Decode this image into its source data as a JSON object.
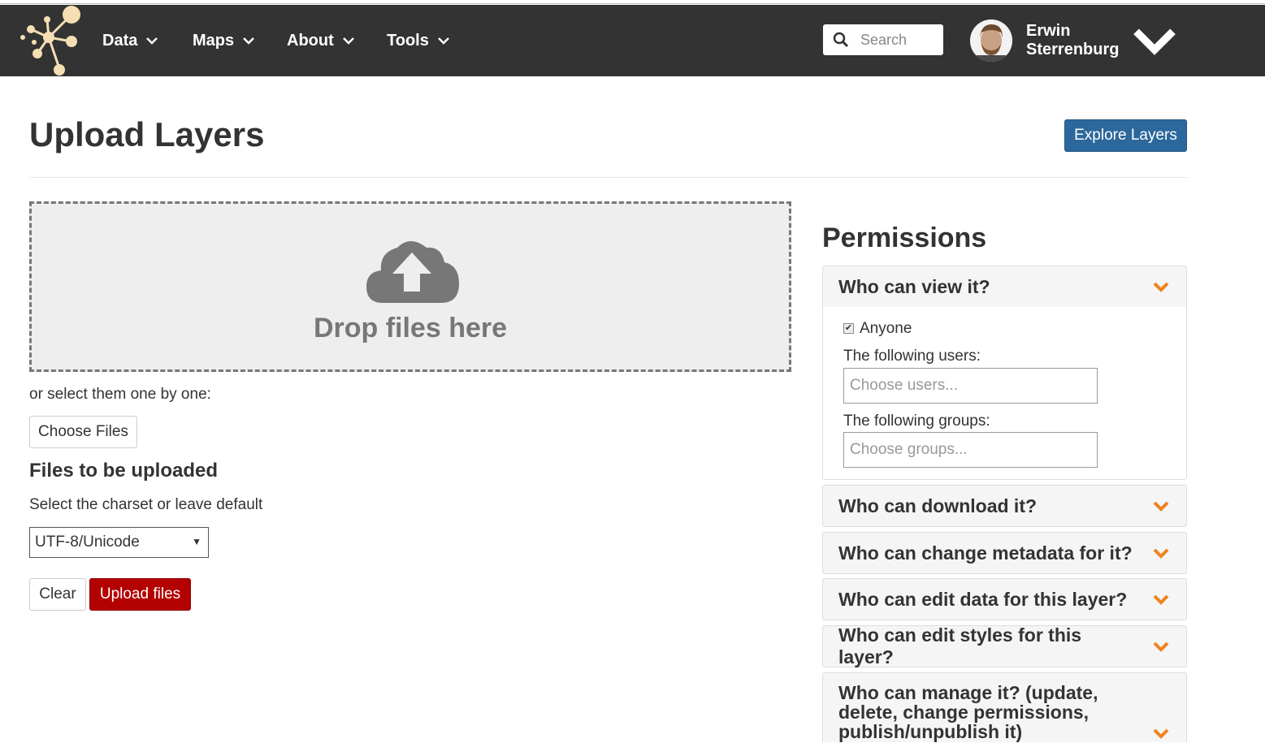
{
  "nav": {
    "items": [
      {
        "label": "Data"
      },
      {
        "label": "Maps"
      },
      {
        "label": "About"
      },
      {
        "label": "Tools"
      }
    ],
    "search_placeholder": "Search",
    "user_name": "Erwin Sterrenburg"
  },
  "header": {
    "title": "Upload Layers",
    "explore_button": "Explore Layers"
  },
  "upload": {
    "drop_text": "Drop files here",
    "select_hint": "or select them one by one:",
    "choose_files": "Choose Files",
    "files_title": "Files to be uploaded",
    "charset_hint": "Select the charset or leave default",
    "charset_value": "UTF-8/Unicode",
    "clear_button": "Clear",
    "upload_button": "Upload files"
  },
  "permissions": {
    "title": "Permissions",
    "view": {
      "heading": "Who can view it?",
      "anyone_label": "Anyone",
      "anyone_checked": true,
      "users_label": "The following users:",
      "users_placeholder": "Choose users...",
      "groups_label": "The following groups:",
      "groups_placeholder": "Choose groups..."
    },
    "download": "Who can download it?",
    "metadata": "Who can change metadata for it?",
    "edit_data": "Who can edit data for this layer?",
    "edit_styles": "Who can edit styles for this layer?",
    "manage": "Who can manage it? (update, delete, change permissions, publish/unpublish it)"
  },
  "colors": {
    "navbar": "#333333",
    "primary": "#2c689c",
    "danger": "#b30000",
    "chevron": "#f0821e",
    "logo": "#f5deb3"
  }
}
